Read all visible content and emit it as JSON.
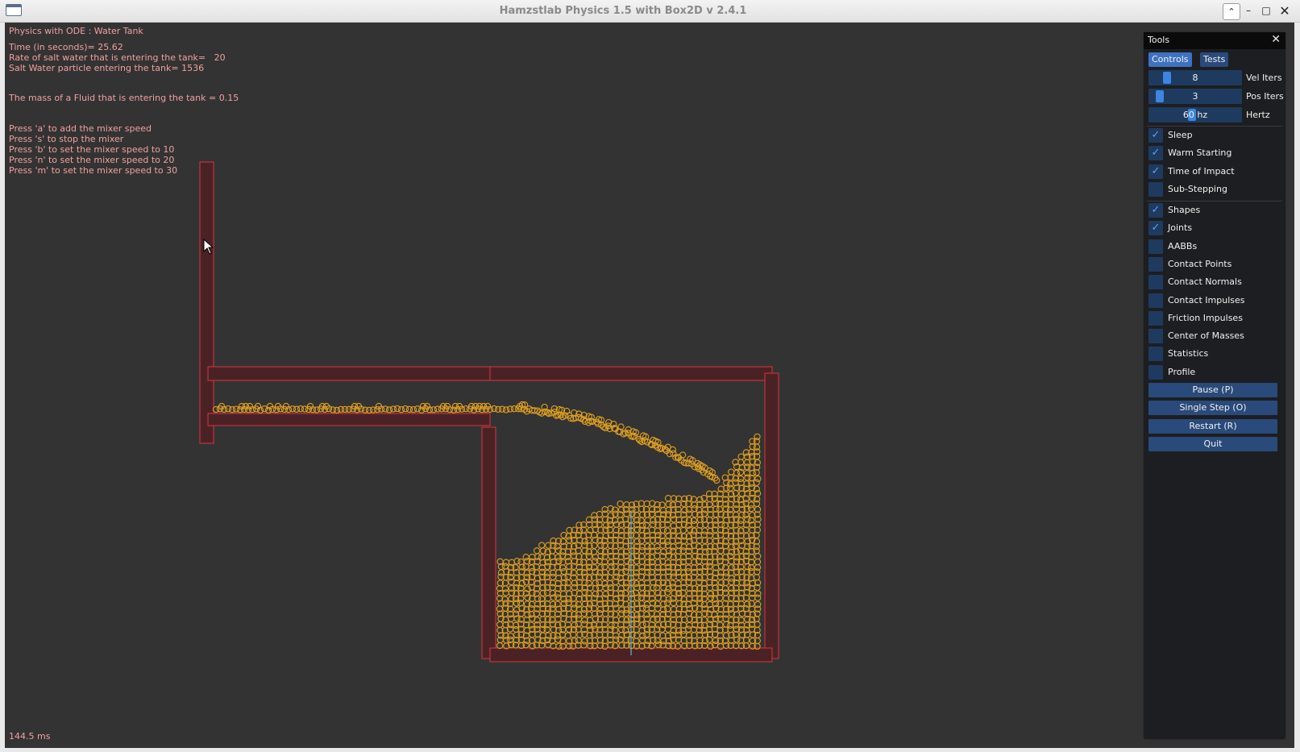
{
  "window": {
    "title": "Hamzstlab Physics 1.5 with Box2D v 2.4.1",
    "controls": {
      "collapse": "⌃",
      "minimize": "–",
      "maximize": "□",
      "close": "✕"
    }
  },
  "overlay": {
    "test_name": "Physics with ODE : Water Tank",
    "lines": [
      "Time (in seconds)= 25.62",
      "Rate of salt water that is entering the tank=   20",
      "Salt Water particle entering the tank= 1536",
      "The mass of a Fluid that is entering the tank = 0.15",
      "Press 'a' to add the mixer speed",
      "Press 's' to stop the mixer",
      "Press 'b' to set the mixer speed to 10",
      "Press 'n' to set the mixer speed to 20",
      "Press 'm' to set the mixer speed to 30"
    ],
    "frame_time": "144.5 ms"
  },
  "tools": {
    "title": "Tools",
    "close_icon": "✕",
    "tabs": [
      {
        "label": "Controls",
        "active": true
      },
      {
        "label": "Tests",
        "active": false
      }
    ],
    "sliders": [
      {
        "value": "8",
        "label": "Vel Iters"
      },
      {
        "value": "3",
        "label": "Pos Iters"
      },
      {
        "value": "60 hz",
        "label": "Hertz"
      }
    ],
    "solver_checks": [
      {
        "label": "Sleep",
        "checked": true
      },
      {
        "label": "Warm Starting",
        "checked": true
      },
      {
        "label": "Time of Impact",
        "checked": true
      },
      {
        "label": "Sub-Stepping",
        "checked": false
      }
    ],
    "draw_checks": [
      {
        "label": "Shapes",
        "checked": true
      },
      {
        "label": "Joints",
        "checked": true
      },
      {
        "label": "AABBs",
        "checked": false
      },
      {
        "label": "Contact Points",
        "checked": false
      },
      {
        "label": "Contact Normals",
        "checked": false
      },
      {
        "label": "Contact Impulses",
        "checked": false
      },
      {
        "label": "Friction Impulses",
        "checked": false
      },
      {
        "label": "Center of Masses",
        "checked": false
      },
      {
        "label": "Statistics",
        "checked": false
      },
      {
        "label": "Profile",
        "checked": false
      }
    ],
    "buttons": [
      "Pause (P)",
      "Single Step (O)",
      "Restart (R)",
      "Quit"
    ],
    "check_mark": "✓"
  },
  "colors": {
    "wall_fill": "#4a2226",
    "wall_stroke": "#d8363c",
    "particle": "#e0a020",
    "mixer_shaft": "#7ab0c8",
    "text": "#f0a0a0",
    "accent": "#3d72c0"
  }
}
